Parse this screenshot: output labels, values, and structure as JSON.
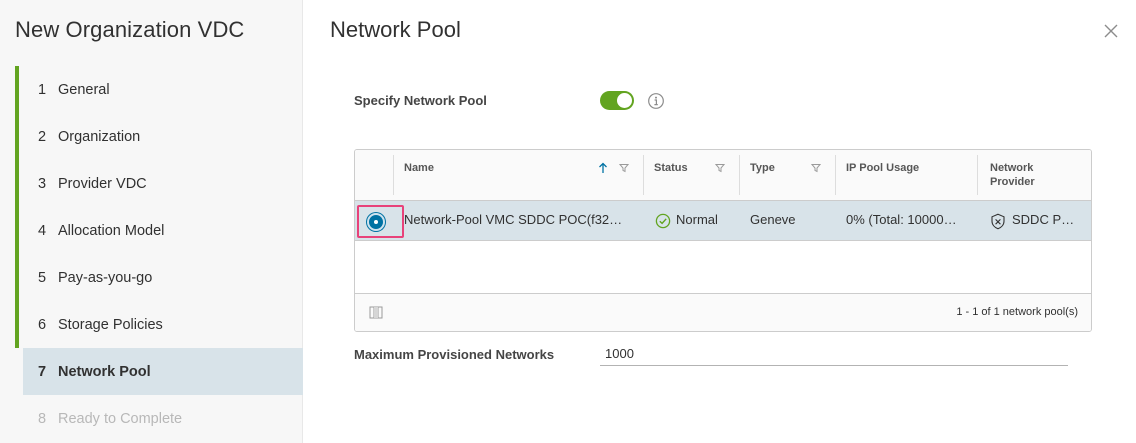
{
  "wizard": {
    "title": "New Organization VDC",
    "steps": [
      {
        "num": "1",
        "label": "General",
        "state": "done"
      },
      {
        "num": "2",
        "label": "Organization",
        "state": "done"
      },
      {
        "num": "3",
        "label": "Provider VDC",
        "state": "done"
      },
      {
        "num": "4",
        "label": "Allocation Model",
        "state": "done"
      },
      {
        "num": "5",
        "label": "Pay-as-you-go",
        "state": "done"
      },
      {
        "num": "6",
        "label": "Storage Policies",
        "state": "done"
      },
      {
        "num": "7",
        "label": "Network Pool",
        "state": "active"
      },
      {
        "num": "8",
        "label": "Ready to Complete",
        "state": "disabled"
      }
    ]
  },
  "page": {
    "title": "Network Pool",
    "close_icon": "close-icon"
  },
  "specify": {
    "label": "Specify Network Pool",
    "enabled": true,
    "info_icon": "info-icon"
  },
  "grid": {
    "columns": {
      "name": "Name",
      "status": "Status",
      "type": "Type",
      "ip_pool_usage": "IP Pool Usage",
      "network_provider_1": "Network",
      "network_provider_2": "Provider"
    },
    "rows": [
      {
        "selected": true,
        "name": "Network-Pool VMC SDDC POC(f32…",
        "status": "Normal",
        "type": "Geneve",
        "ip_pool_usage": "0% (Total: 10000…",
        "network_provider": "SDDC P…"
      }
    ],
    "footer": "1 - 1 of 1 network pool(s)"
  },
  "max_networks": {
    "label": "Maximum Provisioned Networks",
    "value": "1000"
  },
  "colors": {
    "accent_green": "#62a420",
    "selected_row": "#d8e3e9",
    "radio_blue": "#0072a3",
    "highlight_pink": "#e8427a"
  }
}
